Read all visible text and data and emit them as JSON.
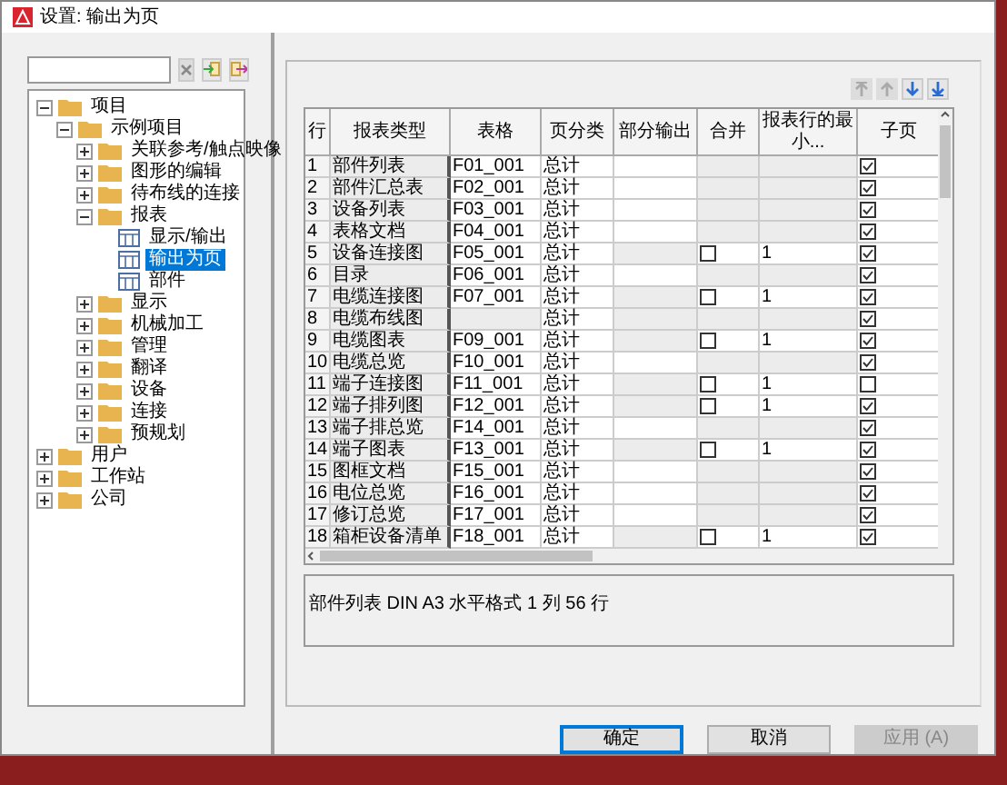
{
  "window": {
    "title": "设置: 输出为页"
  },
  "tree": [
    {
      "label": "项目",
      "expanded": true,
      "selected": false,
      "kind": "folder",
      "children": [
        {
          "label": "示例项目",
          "expanded": true,
          "selected": false,
          "kind": "folder",
          "children": [
            {
              "label": "关联参考/触点映像",
              "expanded": false,
              "selected": false,
              "kind": "folder"
            },
            {
              "label": "图形的编辑",
              "expanded": false,
              "selected": false,
              "kind": "folder"
            },
            {
              "label": "待布线的连接",
              "expanded": false,
              "selected": false,
              "kind": "folder"
            },
            {
              "label": "报表",
              "expanded": true,
              "selected": false,
              "kind": "folder",
              "children": [
                {
                  "label": "显示/输出",
                  "selected": false,
                  "kind": "page"
                },
                {
                  "label": "输出为页",
                  "selected": true,
                  "kind": "page"
                },
                {
                  "label": "部件",
                  "selected": false,
                  "kind": "page"
                }
              ]
            },
            {
              "label": "显示",
              "expanded": false,
              "selected": false,
              "kind": "folder"
            },
            {
              "label": "机械加工",
              "expanded": false,
              "selected": false,
              "kind": "folder"
            },
            {
              "label": "管理",
              "expanded": false,
              "selected": false,
              "kind": "folder"
            },
            {
              "label": "翻译",
              "expanded": false,
              "selected": false,
              "kind": "folder"
            },
            {
              "label": "设备",
              "expanded": false,
              "selected": false,
              "kind": "folder"
            },
            {
              "label": "连接",
              "expanded": false,
              "selected": false,
              "kind": "folder"
            },
            {
              "label": "预规划",
              "expanded": false,
              "selected": false,
              "kind": "folder"
            }
          ]
        }
      ]
    },
    {
      "label": "用户",
      "expanded": false,
      "selected": false,
      "kind": "folder"
    },
    {
      "label": "工作站",
      "expanded": false,
      "selected": false,
      "kind": "folder"
    },
    {
      "label": "公司",
      "expanded": false,
      "selected": false,
      "kind": "folder"
    }
  ],
  "table": {
    "columns": [
      "行",
      "报表类型",
      "表格",
      "页分类",
      "部分输出",
      "合并",
      "报表行的最小...",
      "子页"
    ],
    "rows": [
      {
        "row": "1",
        "type": "部件列表",
        "form": "F01_001",
        "page_class": "总计",
        "merge": null,
        "min_rows": null,
        "subpage": true
      },
      {
        "row": "2",
        "type": "部件汇总表",
        "form": "F02_001",
        "page_class": "总计",
        "merge": null,
        "min_rows": null,
        "subpage": true
      },
      {
        "row": "3",
        "type": "设备列表",
        "form": "F03_001",
        "page_class": "总计",
        "merge": null,
        "min_rows": null,
        "subpage": true
      },
      {
        "row": "4",
        "type": "表格文档",
        "form": "F04_001",
        "page_class": "总计",
        "merge": null,
        "min_rows": null,
        "subpage": true
      },
      {
        "row": "5",
        "type": "设备连接图",
        "form": "F05_001",
        "page_class": "总计",
        "merge": false,
        "min_rows": "1",
        "subpage": true
      },
      {
        "row": "6",
        "type": "目录",
        "form": "F06_001",
        "page_class": "总计",
        "merge": null,
        "min_rows": null,
        "subpage": true
      },
      {
        "row": "7",
        "type": "电缆连接图",
        "form": "F07_001",
        "page_class": "总计",
        "merge": false,
        "min_rows": "1",
        "subpage": true
      },
      {
        "row": "8",
        "type": "电缆布线图",
        "form": null,
        "page_class": "总计",
        "merge": null,
        "min_rows": null,
        "subpage": true
      },
      {
        "row": "9",
        "type": "电缆图表",
        "form": "F09_001",
        "page_class": "总计",
        "merge": false,
        "min_rows": "1",
        "subpage": true
      },
      {
        "row": "10",
        "type": "电缆总览",
        "form": "F10_001",
        "page_class": "总计",
        "merge": null,
        "min_rows": null,
        "subpage": true
      },
      {
        "row": "11",
        "type": "端子连接图",
        "form": "F11_001",
        "page_class": "总计",
        "merge": false,
        "min_rows": "1",
        "subpage": false
      },
      {
        "row": "12",
        "type": "端子排列图",
        "form": "F12_001",
        "page_class": "总计",
        "merge": false,
        "min_rows": "1",
        "subpage": true
      },
      {
        "row": "13",
        "type": "端子排总览",
        "form": "F14_001",
        "page_class": "总计",
        "merge": null,
        "min_rows": null,
        "subpage": true
      },
      {
        "row": "14",
        "type": "端子图表",
        "form": "F13_001",
        "page_class": "总计",
        "merge": false,
        "min_rows": "1",
        "subpage": true
      },
      {
        "row": "15",
        "type": "图框文档",
        "form": "F15_001",
        "page_class": "总计",
        "merge": null,
        "min_rows": null,
        "subpage": true
      },
      {
        "row": "16",
        "type": "电位总览",
        "form": "F16_001",
        "page_class": "总计",
        "merge": null,
        "min_rows": null,
        "subpage": true
      },
      {
        "row": "17",
        "type": "修订总览",
        "form": "F17_001",
        "page_class": "总计",
        "merge": null,
        "min_rows": null,
        "subpage": true
      },
      {
        "row": "18",
        "type": "箱柜设备清单",
        "form": "F18_001",
        "page_class": "总计",
        "merge": false,
        "min_rows": "1",
        "subpage": true
      }
    ]
  },
  "description": "部件列表 DIN A3 水平格式 1 列 56 行",
  "buttons": [
    {
      "label": "确定",
      "disabled": false,
      "default": true
    },
    {
      "label": "取消",
      "disabled": false,
      "default": false
    },
    {
      "label": "应用 (A)",
      "disabled": true,
      "default": false
    }
  ]
}
